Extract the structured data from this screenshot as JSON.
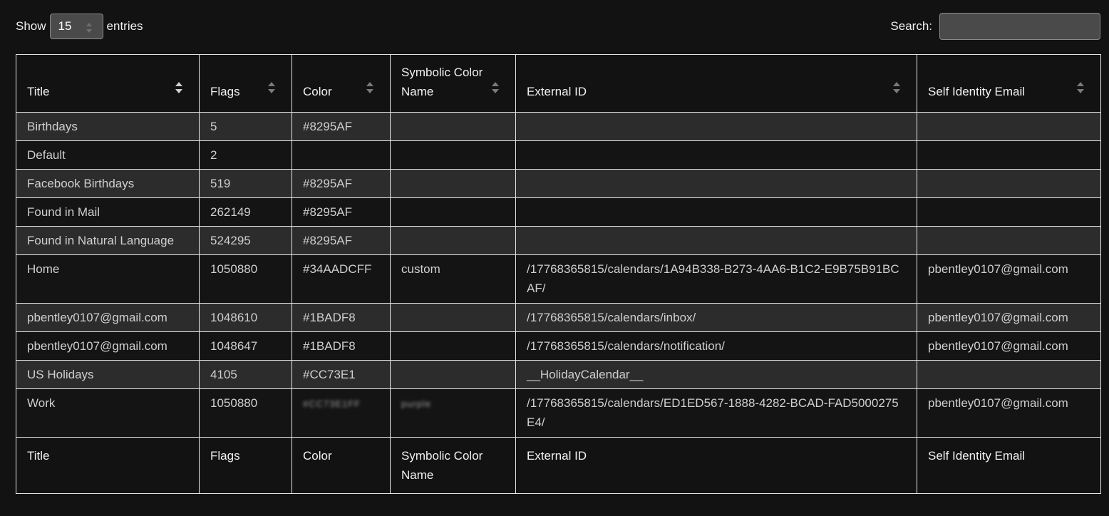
{
  "length_control": {
    "show_label": "Show",
    "value": "15",
    "entries_label": "entries"
  },
  "search": {
    "label": "Search:",
    "value": ""
  },
  "columns": [
    "Title",
    "Flags",
    "Color",
    "Symbolic Color Name",
    "External ID",
    "Self Identity Email"
  ],
  "rows": [
    {
      "title": "Birthdays",
      "flags": "5",
      "color": "#8295AF",
      "symbolic": "",
      "external_id": "",
      "email": ""
    },
    {
      "title": "Default",
      "flags": "2",
      "color": "",
      "symbolic": "",
      "external_id": "",
      "email": ""
    },
    {
      "title": "Facebook Birthdays",
      "flags": "519",
      "color": "#8295AF",
      "symbolic": "",
      "external_id": "",
      "email": ""
    },
    {
      "title": "Found in Mail",
      "flags": "262149",
      "color": "#8295AF",
      "symbolic": "",
      "external_id": "",
      "email": ""
    },
    {
      "title": "Found in Natural Language",
      "flags": "524295",
      "color": "#8295AF",
      "symbolic": "",
      "external_id": "",
      "email": ""
    },
    {
      "title": "Home",
      "flags": "1050880",
      "color": "#34AADCFF",
      "symbolic": "custom",
      "external_id": "/17768365815/calendars/1A94B338-B273-4AA6-B1C2-E9B75B91BCAF/",
      "email": "pbentley0107@gmail.com"
    },
    {
      "title": "pbentley0107@gmail.com",
      "flags": "1048610",
      "color": "#1BADF8",
      "symbolic": "",
      "external_id": "/17768365815/calendars/inbox/",
      "email": "pbentley0107@gmail.com"
    },
    {
      "title": "pbentley0107@gmail.com",
      "flags": "1048647",
      "color": "#1BADF8",
      "symbolic": "",
      "external_id": "/17768365815/calendars/notification/",
      "email": "pbentley0107@gmail.com"
    },
    {
      "title": "US Holidays",
      "flags": "4105",
      "color": "#CC73E1",
      "symbolic": "",
      "external_id": "__HolidayCalendar__",
      "email": ""
    },
    {
      "title": "Work",
      "flags": "1050880",
      "color": "#CC73E1FF",
      "symbolic": "purple",
      "external_id": "/17768365815/calendars/ED1ED567-1888-4282-BCAD-FAD5000275E4/",
      "email": "pbentley0107@gmail.com"
    }
  ],
  "colors": {
    "background": "#121212",
    "row_odd": "#2c2c2c",
    "row_even": "#141414",
    "border": "#e6e6e6",
    "text": "#cfcfcf",
    "control_bg": "#4a4a4a"
  }
}
